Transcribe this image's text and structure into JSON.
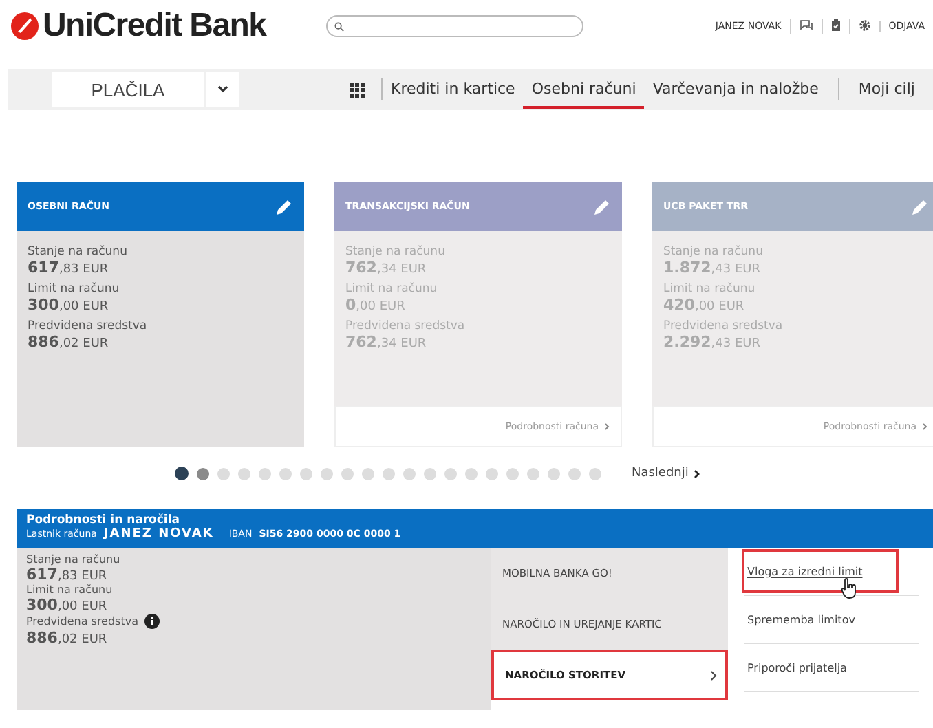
{
  "header": {
    "logo": "UniCredit Bank",
    "user": "JANEZ NOVAK",
    "logout": "ODJAVA"
  },
  "nav": {
    "section": "PLAČILA",
    "links": [
      {
        "label": "Krediti in kartice",
        "selected": false
      },
      {
        "label": "Osebni računi",
        "selected": true
      },
      {
        "label": "Varčevanja in naložbe",
        "selected": false
      },
      {
        "label": "Moji cilj",
        "selected": false
      }
    ]
  },
  "cards": [
    {
      "title": "OSEBNI RAČUN",
      "selected": true,
      "color": "#0a6fc2",
      "rows": [
        {
          "label": "Stanje na računu",
          "value": "**617**,83 EUR"
        },
        {
          "label": "Limit na računu",
          "value": "**300**,00 EUR"
        },
        {
          "label": "Predvidena sredstva",
          "value": "**886**,02 EUR"
        }
      ]
    },
    {
      "title": "TRANSAKCIJSKI RAČUN",
      "selected": false,
      "color": "#9c9fc6",
      "rows": [
        {
          "label": "Stanje na računu",
          "value": "**762**,34 EUR"
        },
        {
          "label": "Limit na računu",
          "value": "**0**,00 EUR"
        },
        {
          "label": "Predvidena sredstva",
          "value": "**762**,34 EUR"
        }
      ],
      "link": "Podrobnosti računa"
    },
    {
      "title": "UCB PAKET TRR",
      "selected": false,
      "color": "#a6b2c6",
      "rows": [
        {
          "label": "Stanje na računu",
          "value": "**1.872**,43 EUR"
        },
        {
          "label": "Limit na računu",
          "value": "**420**,00 EUR"
        },
        {
          "label": "Predvidena sredstva",
          "value": "**2.292**,43 EUR"
        }
      ],
      "link": "Podrobnosti računa"
    }
  ],
  "pager": {
    "dots": [
      {
        "selected": true,
        "color": "#2c4257"
      },
      {
        "selected": false,
        "color": "#8a8a8a"
      },
      {
        "selected": false,
        "color": "#dddddd"
      },
      {
        "selected": false,
        "color": "#dddddd"
      },
      {
        "selected": false,
        "color": "#dddddd"
      },
      {
        "selected": false,
        "color": "#dddddd"
      },
      {
        "selected": false,
        "color": "#dddddd"
      },
      {
        "selected": false,
        "color": "#dddddd"
      },
      {
        "selected": false,
        "color": "#dddddd"
      },
      {
        "selected": false,
        "color": "#dddddd"
      },
      {
        "selected": false,
        "color": "#dddddd"
      },
      {
        "selected": false,
        "color": "#dddddd"
      },
      {
        "selected": false,
        "color": "#dddddd"
      },
      {
        "selected": false,
        "color": "#dddddd"
      },
      {
        "selected": false,
        "color": "#dddddd"
      },
      {
        "selected": false,
        "color": "#dddddd"
      },
      {
        "selected": false,
        "color": "#dddddd"
      },
      {
        "selected": false,
        "color": "#dddddd"
      },
      {
        "selected": false,
        "color": "#dddddd"
      },
      {
        "selected": false,
        "color": "#dddddd"
      },
      {
        "selected": false,
        "color": "#dddddd"
      }
    ],
    "next": "Naslednji"
  },
  "details": {
    "title": "Podrobnosti in naročila",
    "owner_label": "Lastnik računa",
    "owner": "JANEZ NOVAK",
    "iban_label": "IBAN",
    "iban": "SI56 2900 0000 0C 0000 1",
    "rows": [
      {
        "label": "Stanje na računu",
        "value": "**617**,83 EUR",
        "info": false
      },
      {
        "label": "Limit na računu",
        "value": "**300**,00 EUR",
        "info": false
      },
      {
        "label": "Predvidena sredstva",
        "value": "**886**,02 EUR",
        "info": true
      }
    ],
    "menu": [
      {
        "label": "MOBILNA BANKA GO!",
        "selected": false,
        "highlighted": false
      },
      {
        "label": "NAROČILO IN UREJANJE KARTIC",
        "selected": false,
        "highlighted": false
      },
      {
        "label": "NAROČILO STORITEV",
        "selected": true,
        "highlighted": true
      }
    ],
    "links": [
      {
        "label": "Vloga za izredni limit",
        "highlighted": true,
        "hovered": true
      },
      {
        "label": "Sprememba limitov",
        "highlighted": false,
        "hovered": false
      },
      {
        "label": "Priporoči prijatelja",
        "highlighted": false,
        "hovered": false
      }
    ]
  }
}
